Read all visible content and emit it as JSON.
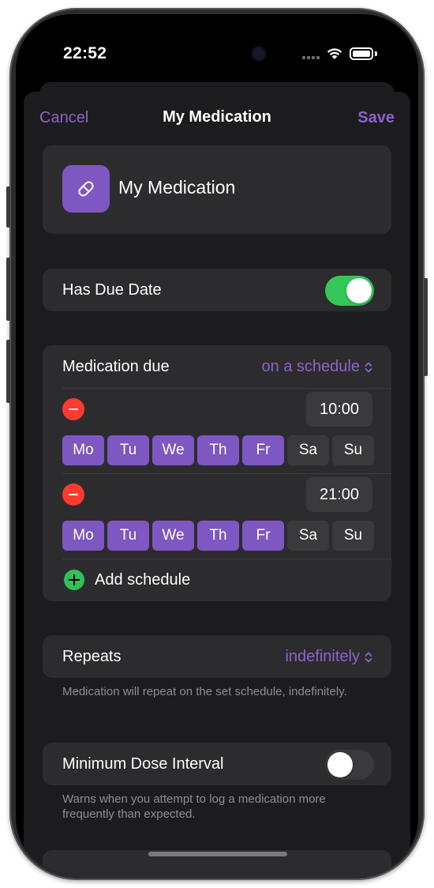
{
  "status_bar": {
    "time": "22:52"
  },
  "nav": {
    "cancel": "Cancel",
    "title": "My Medication",
    "save": "Save"
  },
  "medication": {
    "name": "My Medication",
    "icon": "pill-icon",
    "accent": "#7e57c2"
  },
  "has_due_date": {
    "label": "Has Due Date",
    "enabled": true
  },
  "schedule": {
    "label": "Medication due",
    "value": "on a schedule",
    "entries": [
      {
        "time": "10:00",
        "days": [
          {
            "label": "Mo",
            "selected": true
          },
          {
            "label": "Tu",
            "selected": true
          },
          {
            "label": "We",
            "selected": true
          },
          {
            "label": "Th",
            "selected": true
          },
          {
            "label": "Fr",
            "selected": true
          },
          {
            "label": "Sa",
            "selected": false
          },
          {
            "label": "Su",
            "selected": false
          }
        ]
      },
      {
        "time": "21:00",
        "days": [
          {
            "label": "Mo",
            "selected": true
          },
          {
            "label": "Tu",
            "selected": true
          },
          {
            "label": "We",
            "selected": true
          },
          {
            "label": "Th",
            "selected": true
          },
          {
            "label": "Fr",
            "selected": true
          },
          {
            "label": "Sa",
            "selected": false
          },
          {
            "label": "Su",
            "selected": false
          }
        ]
      }
    ],
    "add_label": "Add schedule"
  },
  "repeats": {
    "label": "Repeats",
    "value": "indefinitely",
    "footnote": "Medication will repeat on the set schedule, indefinitely."
  },
  "min_dose_interval": {
    "label": "Minimum Dose Interval",
    "enabled": false,
    "footnote": "Warns when you attempt to log a medication more frequently than expected."
  },
  "colors": {
    "accent": "#8e63c9",
    "toggle_on": "#34c759",
    "remove": "#ff3b30",
    "add": "#30c158"
  }
}
